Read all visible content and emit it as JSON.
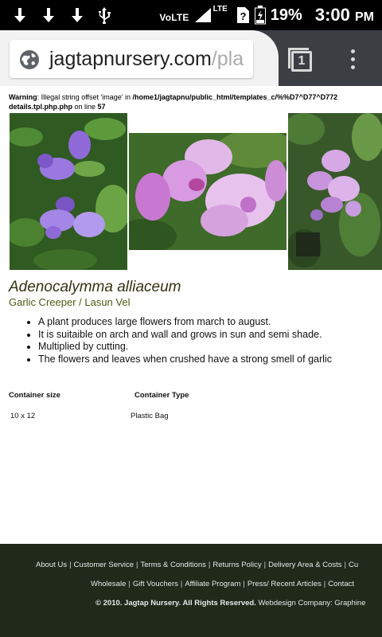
{
  "status_bar": {
    "volte": "VoLTE",
    "lte": "LTE",
    "battery_percent": "19%",
    "time": "3:00",
    "ampm": "PM"
  },
  "browser": {
    "url_main": "jagtapnursery.com",
    "url_rest": "/pla",
    "tab_count": "1"
  },
  "warning": {
    "label": "Warning",
    "message": ": Illegal string offset 'image' in ",
    "path": "/home1/jagtapnu/public_html/templates_c/%%D7^D77^D772",
    "file": "details.tpl.php.php",
    "on_line": " on line ",
    "line": "57"
  },
  "plant": {
    "name": "Adenocalymma alliaceum",
    "common_names": "Garlic Creeper / Lasun Vel",
    "features": [
      "A plant produces large flowers from march to august.",
      "It is suitaible on arch and wall and grows in sun and semi shade.",
      "Multiplied by cutting.",
      "The flowers and leaves when crushed have a strong smell of garlic"
    ],
    "spec_headers": [
      "Container size",
      "Container Type"
    ],
    "spec_values": [
      "10 x 12",
      "Plastic Bag"
    ]
  },
  "footer": {
    "links_row1": [
      "About Us",
      "Customer Service",
      "Terms & Conditions",
      "Returns Policy",
      "Delivery Area & Costs",
      "Cu"
    ],
    "links_row2": [
      "Wholesale",
      "Gift Vouchers",
      "Affiliate Program",
      "Press/ Recent Articles",
      "Contact"
    ],
    "copyright": "© 2010. Jagtap Nursery. All Rights Reserved.",
    "webdesign": " Webdesign Company: Graphine"
  },
  "colors": {
    "footer_bg": "#20291a",
    "title_color": "#333311",
    "subtitle_color": "#4b5a10",
    "chrome_dark": "#3b3f44"
  }
}
